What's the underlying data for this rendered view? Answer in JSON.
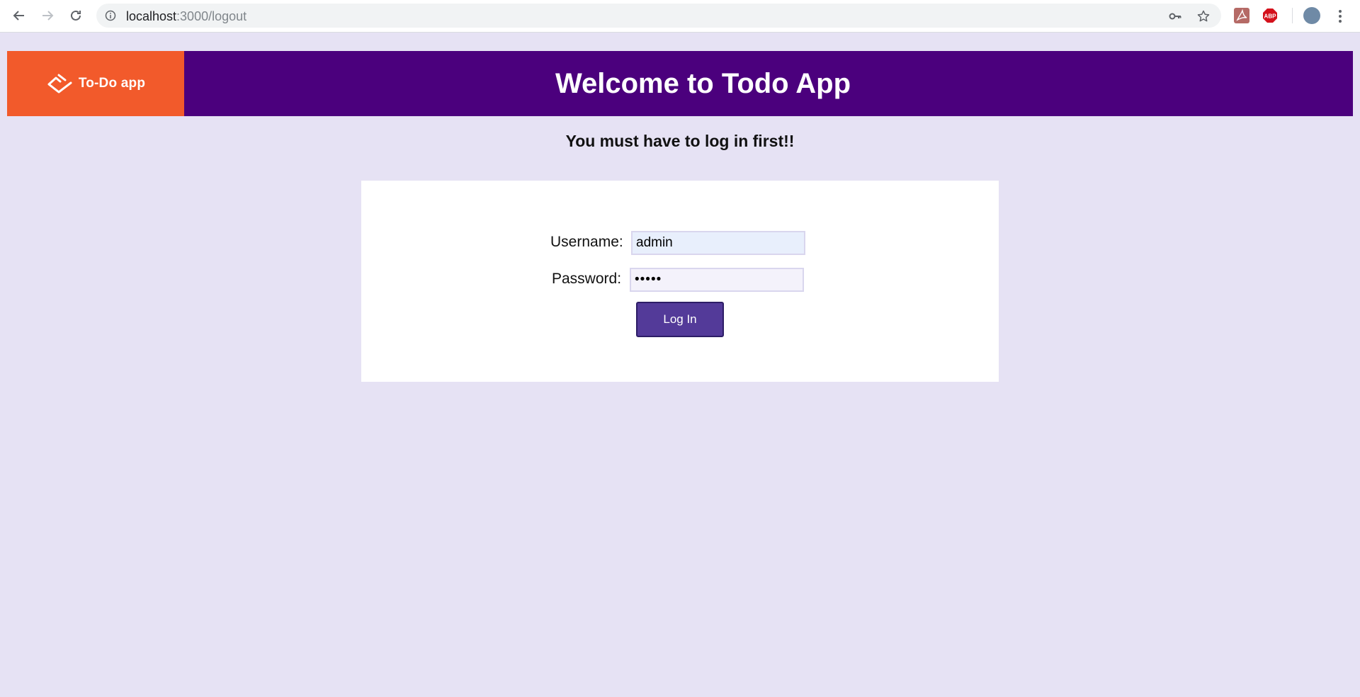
{
  "browser": {
    "url_host": "localhost",
    "url_path": ":3000/logout"
  },
  "header": {
    "logo_text": "To-Do app",
    "title": "Welcome to Todo App"
  },
  "notice": "You must have to log in first!!",
  "login": {
    "username_label": "Username:",
    "username_value": "admin",
    "password_label": "Password:",
    "password_value": "•••••",
    "submit_label": "Log In"
  },
  "colors": {
    "page_bg": "#e6e2f4",
    "header_bg": "#4b007d",
    "logo_bg": "#f25a2b",
    "button_bg": "#533a99"
  }
}
